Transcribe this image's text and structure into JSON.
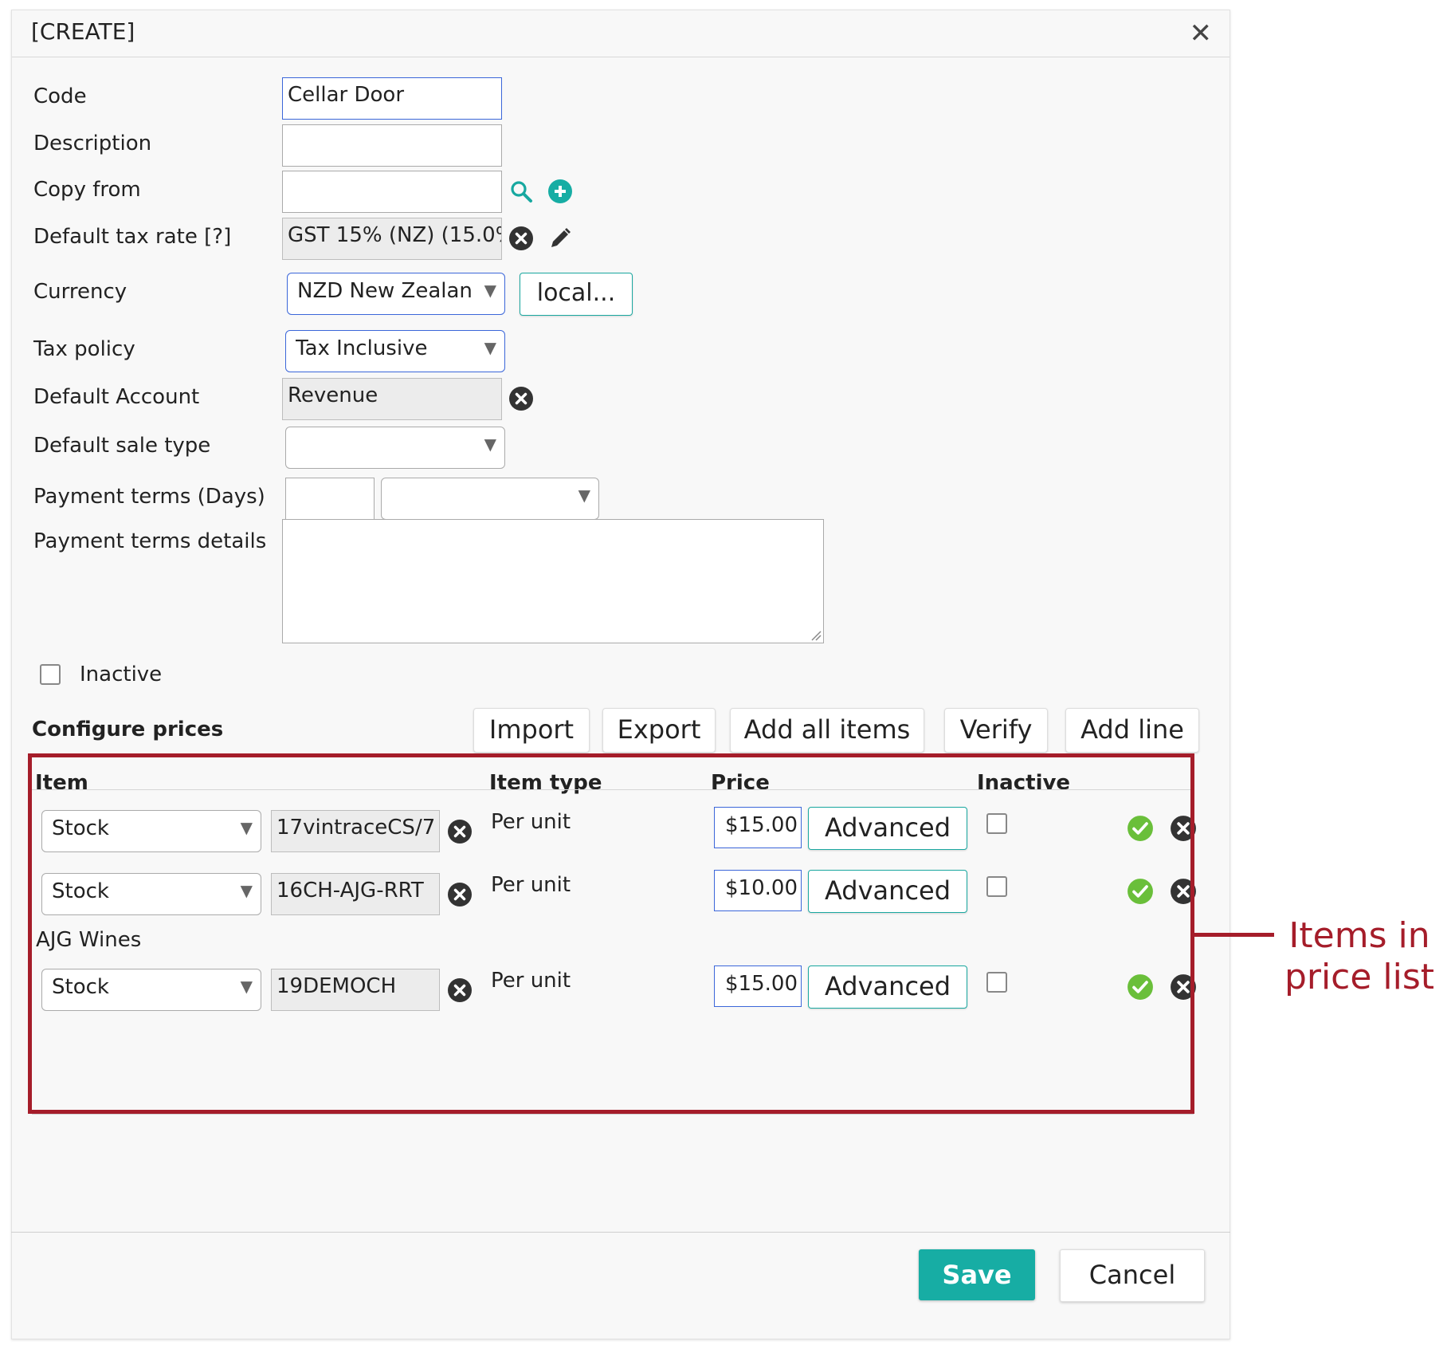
{
  "dialog": {
    "title": "[CREATE]",
    "close_glyph": "✕"
  },
  "form": {
    "code": {
      "label": "Code",
      "value": "Cellar Door"
    },
    "description": {
      "label": "Description",
      "value": ""
    },
    "copy_from": {
      "label": "Copy from",
      "value": ""
    },
    "default_tax_rate": {
      "label": "Default tax rate [?]",
      "value": "GST 15% (NZ) (15.0%"
    },
    "currency": {
      "label": "Currency",
      "value": "NZD New Zealan",
      "local_button": "local..."
    },
    "tax_policy": {
      "label": "Tax policy",
      "value": "Tax Inclusive"
    },
    "default_account": {
      "label": "Default Account",
      "value": "Revenue"
    },
    "default_sale_type": {
      "label": "Default sale type",
      "value": ""
    },
    "payment_terms": {
      "label": "Payment terms (Days)",
      "days": "",
      "unit": ""
    },
    "payment_terms_details": {
      "label": "Payment terms details",
      "value": ""
    },
    "inactive": {
      "label": "Inactive",
      "checked": false
    }
  },
  "prices": {
    "section_title": "Configure prices",
    "buttons": {
      "import": "Import",
      "export": "Export",
      "add_all": "Add all items",
      "verify": "Verify",
      "add_line": "Add line"
    },
    "columns": {
      "item": "Item",
      "item_type": "Item type",
      "price": "Price",
      "inactive": "Inactive"
    },
    "rows": [
      {
        "kind": "Stock",
        "code": "17vintraceCS/7",
        "item_type": "Per unit",
        "price": "$15.00",
        "advanced": "Advanced",
        "inactive": false
      },
      {
        "kind": "Stock",
        "code": "16CH-AJG-RRT",
        "item_type": "Per unit",
        "price": "$10.00",
        "advanced": "Advanced",
        "inactive": false,
        "sub_label": "AJG Wines"
      },
      {
        "kind": "Stock",
        "code": "19DEMOCH",
        "item_type": "Per unit",
        "price": "$15.00",
        "advanced": "Advanced",
        "inactive": false
      }
    ]
  },
  "footer": {
    "save": "Save",
    "cancel": "Cancel"
  },
  "annotation": {
    "line1": "Items in",
    "line2": "price list",
    "color": "#a51d2a"
  },
  "colors": {
    "accent": "#17ada4",
    "focus": "#3b66d9",
    "ok": "#6abf3a",
    "remove": "#333333"
  },
  "icons": [
    "close-icon",
    "search-icon",
    "add-circle-icon",
    "clear-icon",
    "edit-pencil-icon",
    "dropdown-arrow-icon",
    "check-circle-icon",
    "remove-circle-icon",
    "resize-handle-icon"
  ]
}
